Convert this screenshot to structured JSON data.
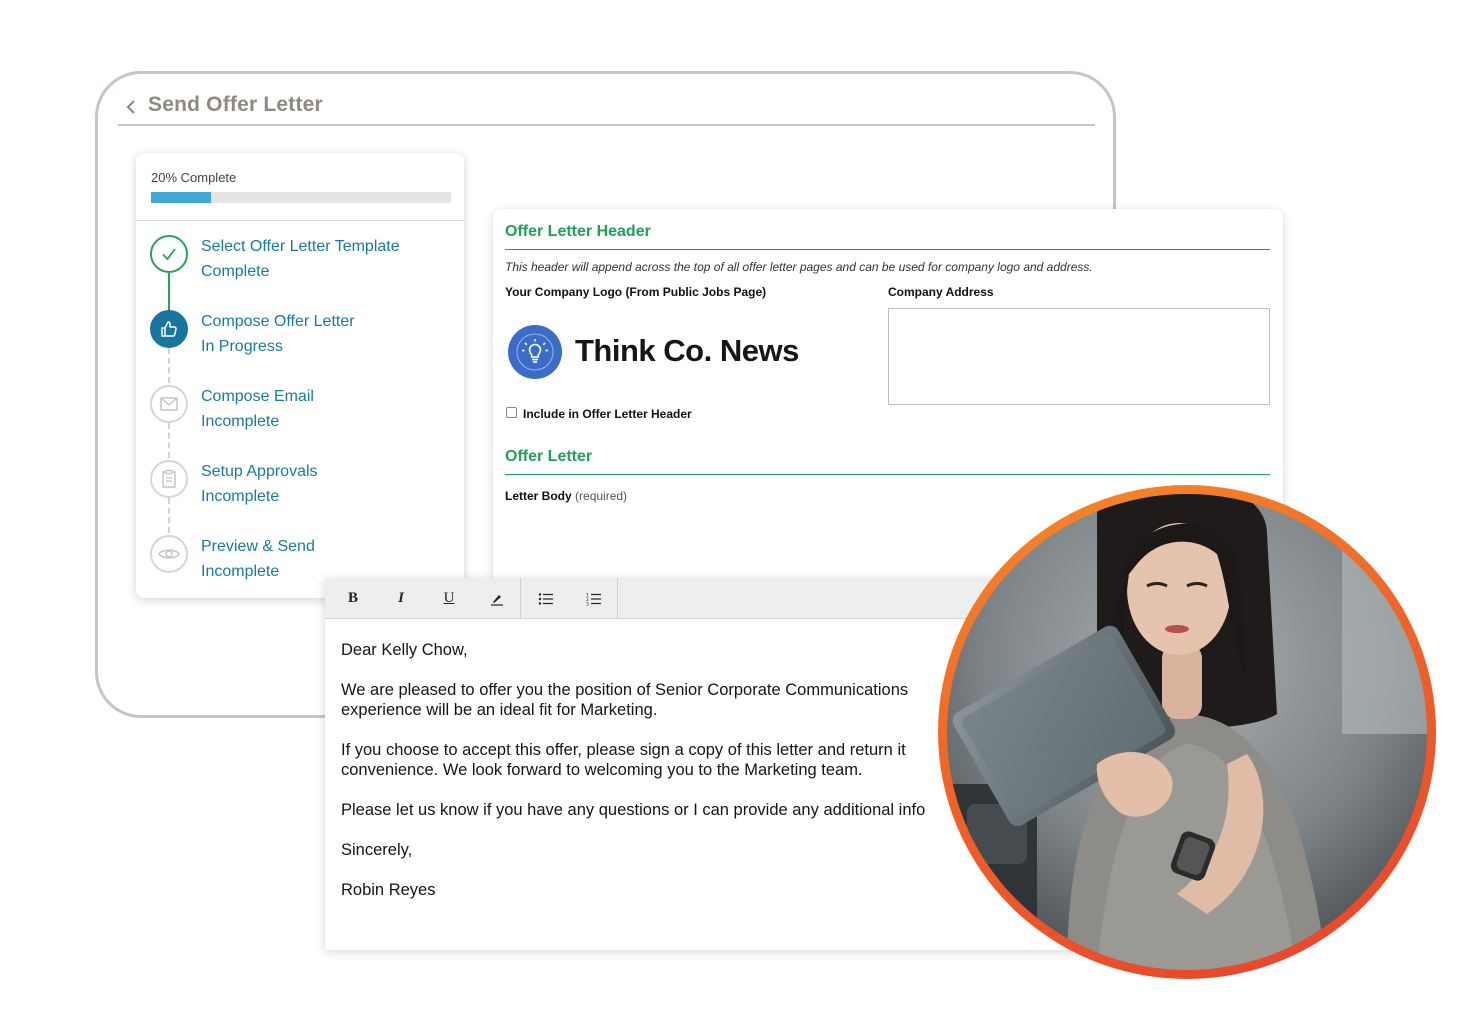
{
  "window": {
    "title": "Send Offer Letter"
  },
  "progress": {
    "label": "20% Complete",
    "percent": 20
  },
  "steps": [
    {
      "name": "Select Offer Letter Template",
      "status": "Complete",
      "icon": "check-icon"
    },
    {
      "name": "Compose Offer Letter",
      "status": "In Progress",
      "icon": "thumbs-up-icon"
    },
    {
      "name": "Compose Email",
      "status": "Incomplete",
      "icon": "envelope-icon"
    },
    {
      "name": "Setup Approvals",
      "status": "Incomplete",
      "icon": "clipboard-icon"
    },
    {
      "name": "Preview & Send",
      "status": "Incomplete",
      "icon": "eye-icon"
    }
  ],
  "header_section": {
    "title": "Offer Letter Header",
    "description": "This header will append across the top of all offer letter pages and can be used for company logo and address.",
    "logo_label": "Your Company Logo (From Public Jobs Page)",
    "logo_text": "Think Co. News",
    "address_label": "Company Address",
    "address_value": "",
    "include_label": "Include in Offer Letter Header",
    "include_checked": false
  },
  "letter_section": {
    "title": "Offer Letter",
    "body_label": "Letter Body",
    "body_required": "(required)"
  },
  "toolbar": {
    "bold": "B",
    "italic": "I",
    "underline": "U"
  },
  "letter": {
    "greeting": "Dear Kelly Chow,",
    "p1_line1": "We are pleased to offer you the position of Senior Corporate Communications",
    "p1_line2": "experience will be an ideal fit for Marketing.",
    "p2_line1": "If you choose to accept this offer, please sign a copy of this letter and return it",
    "p2_line2": "convenience.  We look forward to welcoming you to the Marketing team.",
    "p3": "Please let us know if you have any questions or I can provide any additional info",
    "closing": "Sincerely,",
    "signature": "Robin Reyes"
  },
  "colors": {
    "accent_green": "#21a05a",
    "accent_blue": "#177a9e",
    "progress_blue": "#3fa9d6",
    "ring_orange": "#f06428"
  }
}
